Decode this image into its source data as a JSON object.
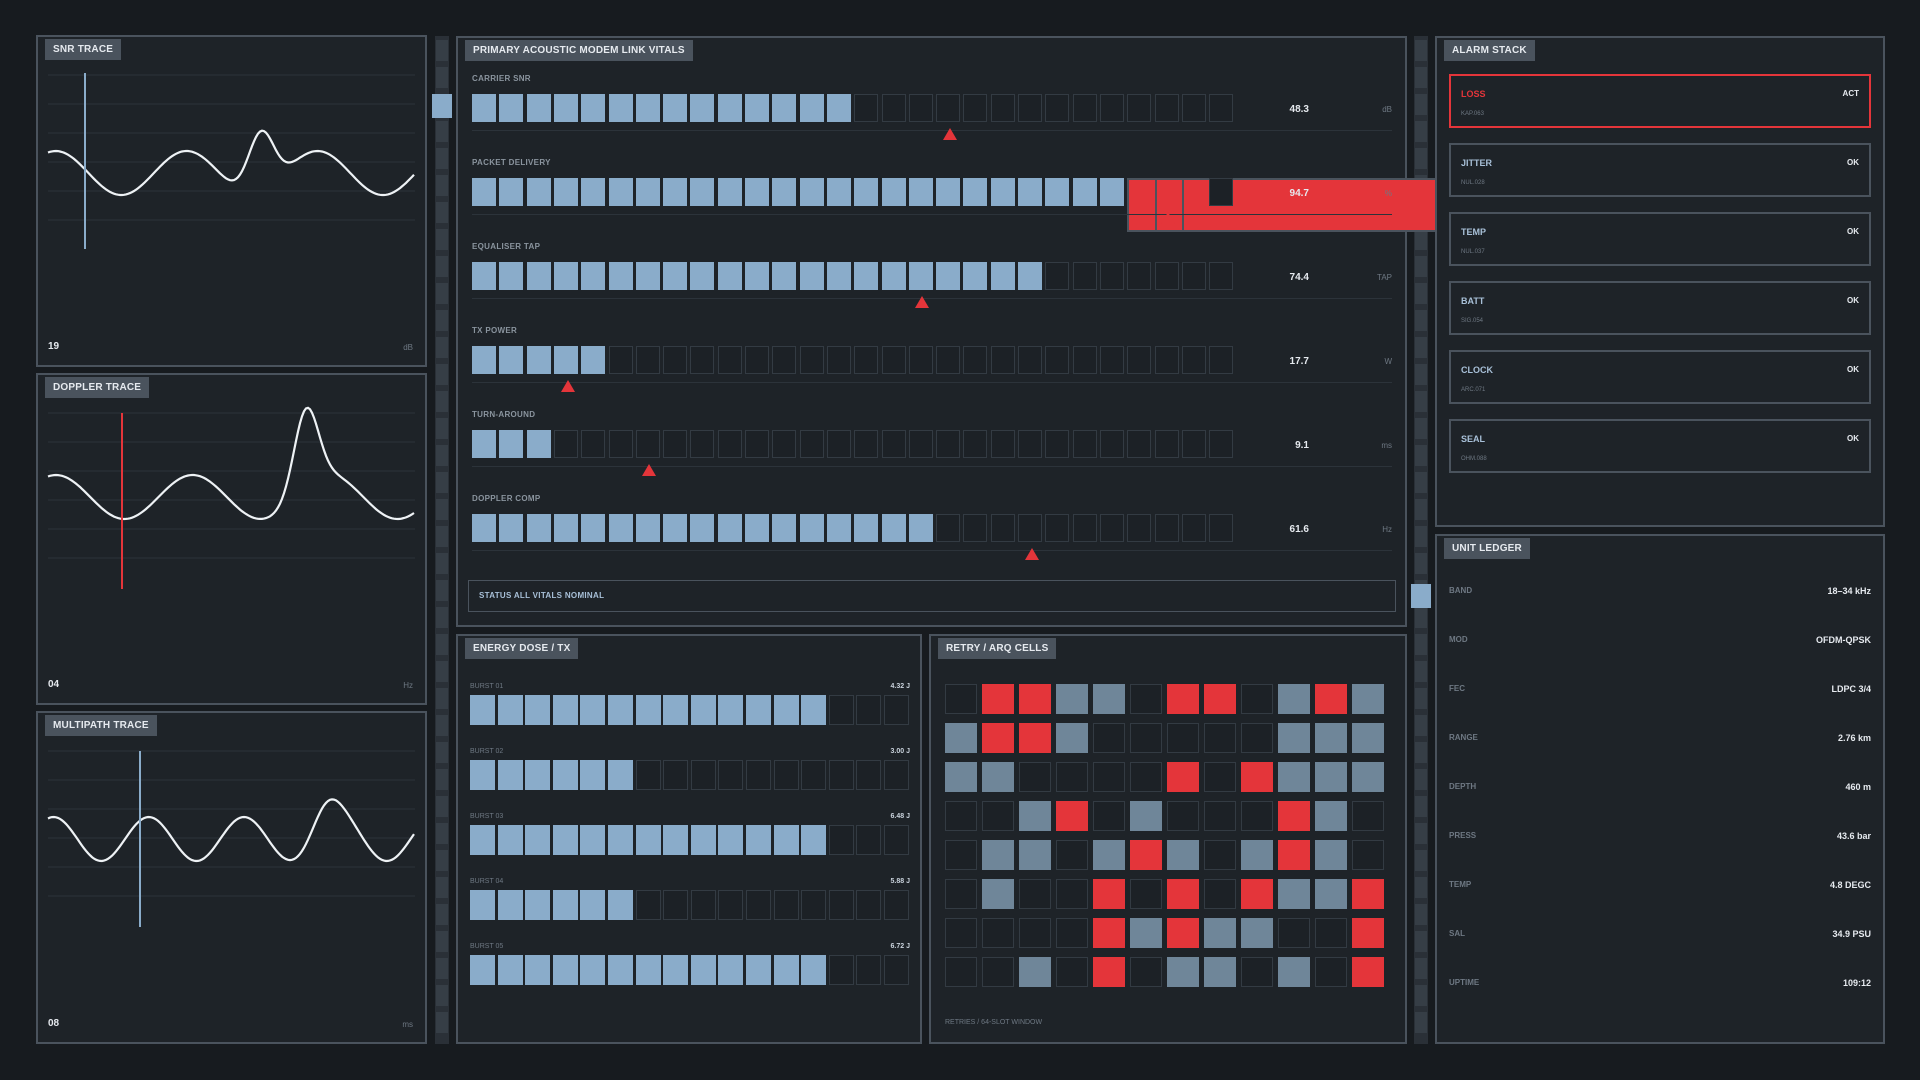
{
  "colors": {
    "accent": "#8aacca",
    "alarm": "#e4353a",
    "frame": "#4a535d",
    "bg": "#171b1f"
  },
  "traces": [
    {
      "title": "SNR TRACE",
      "value": "19",
      "unit": "dB",
      "cursor_color": "#8aacca"
    },
    {
      "title": "DOPPLER TRACE",
      "value": "04",
      "unit": "Hz",
      "cursor_color": "#e4353a"
    },
    {
      "title": "MULTIPATH TRACE",
      "value": "08",
      "unit": "ms",
      "cursor_color": "#8aacca"
    }
  ],
  "vitals": {
    "title": "PRIMARY  ACOUSTIC MODEM LINK VITALS",
    "segment_count": 28,
    "rows": [
      {
        "label": "CARRIER SNR",
        "value": "48.3",
        "unit": "dB",
        "lit": 14,
        "alarm": 0,
        "marker": 17.5
      },
      {
        "label": "PACKET DELIVERY",
        "value": "94.7",
        "unit": "%",
        "lit": 24,
        "alarm": 3,
        "marker": 25.5
      },
      {
        "label": "EQUALISER TAP",
        "value": "74.4",
        "unit": "TAP",
        "lit": 21,
        "alarm": 0,
        "marker": 16.5
      },
      {
        "label": "TX POWER",
        "value": "17.7",
        "unit": "W",
        "lit": 5,
        "alarm": 0,
        "marker": 3.5
      },
      {
        "label": "TURN-AROUND",
        "value": "9.1",
        "unit": "ms",
        "lit": 3,
        "alarm": 0,
        "marker": 6.5
      },
      {
        "label": "DOPPLER COMP",
        "value": "61.6",
        "unit": "Hz",
        "lit": 17,
        "alarm": 0,
        "marker": 20.5
      }
    ],
    "status": "STATUS  ALL VITALS NOMINAL"
  },
  "energy": {
    "title": "ENERGY DOSE / TX",
    "segment_count": 16,
    "rows": [
      {
        "label": "BURST 01",
        "value": "4.32 J",
        "lit": 13
      },
      {
        "label": "BURST 02",
        "value": "3.00 J",
        "lit": 6
      },
      {
        "label": "BURST 03",
        "value": "6.48 J",
        "lit": 13
      },
      {
        "label": "BURST 04",
        "value": "5.88 J",
        "lit": 6
      },
      {
        "label": "BURST 05",
        "value": "6.72 J",
        "lit": 13
      }
    ]
  },
  "retry": {
    "title": "RETRY / ARQ CELLS",
    "caption": "RETRIES / 64-SLOT WINDOW",
    "grid": [
      "0RRBB0RR0BRB",
      "BRRB00000BBB",
      "BB0000R0RBBB",
      "00BR0B000RB0",
      "0BB0BRB0BRB0",
      "0B00R0R0RBBR",
      "0000RBRBB00R",
      "00B0R0BB0B0R"
    ]
  },
  "alarms": {
    "title": "ALARM STACK",
    "items": [
      {
        "name": "LOSS",
        "code": "KAP.063",
        "state": "ACT",
        "active": true
      },
      {
        "name": "JITTER",
        "code": "NUL.028",
        "state": "OK",
        "active": false
      },
      {
        "name": "TEMP",
        "code": "NUL.037",
        "state": "OK",
        "active": false
      },
      {
        "name": "BATT",
        "code": "SIG.054",
        "state": "OK",
        "active": false
      },
      {
        "name": "CLOCK",
        "code": "ARC.071",
        "state": "OK",
        "active": false
      },
      {
        "name": "SEAL",
        "code": "OHM.088",
        "state": "OK",
        "active": false
      }
    ]
  },
  "ledger": {
    "title": "UNIT LEDGER",
    "rows": [
      {
        "key": "BAND",
        "value": "18–34 kHz"
      },
      {
        "key": "MOD",
        "value": "OFDM-QPSK"
      },
      {
        "key": "FEC",
        "value": "LDPC 3/4"
      },
      {
        "key": "RANGE",
        "value": "2.76 km"
      },
      {
        "key": "DEPTH",
        "value": "460 m"
      },
      {
        "key": "PRESS",
        "value": "43.6 bar"
      },
      {
        "key": "TEMP",
        "value": "4.8  DEGC"
      },
      {
        "key": "SAL",
        "value": "34.9 PSU"
      },
      {
        "key": "UPTIME",
        "value": "109:12"
      }
    ]
  }
}
